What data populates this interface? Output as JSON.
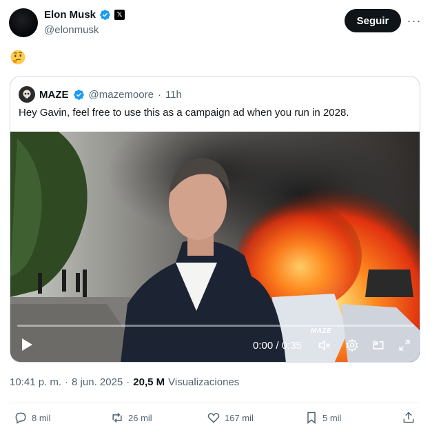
{
  "author": {
    "display_name": "Elon Musk",
    "handle": "@elonmusk",
    "badge": "verified",
    "affiliation_icon": "x-logo"
  },
  "header": {
    "follow_label": "Seguir",
    "more_label": "···"
  },
  "post": {
    "emoji": "thinking-face-emoji"
  },
  "quote": {
    "display_name": "MAZE",
    "handle": "@mazemoore",
    "separator": "·",
    "time_ago": "11h",
    "text": "Hey Gavin, feel free to use this as a campaign ad when you run in 2028.",
    "video": {
      "current_time": "0:00",
      "duration": "0:35",
      "time_display": "0:00 / 0:35",
      "progress": 0,
      "watermark": "MAZE"
    }
  },
  "meta": {
    "time": "10:41 p. m.",
    "separator": "·",
    "date": "8 jun. 2025",
    "views": "20,5 M",
    "views_label": "Visualizaciones"
  },
  "actions": {
    "replies": "8 mil",
    "reposts": "26 mil",
    "likes": "167 mil",
    "bookmarks": "5 mil"
  },
  "colors": {
    "text_primary": "#0f1419",
    "text_secondary": "#536471",
    "verified_blue": "#1d9bf0",
    "border": "#cfd9de"
  }
}
